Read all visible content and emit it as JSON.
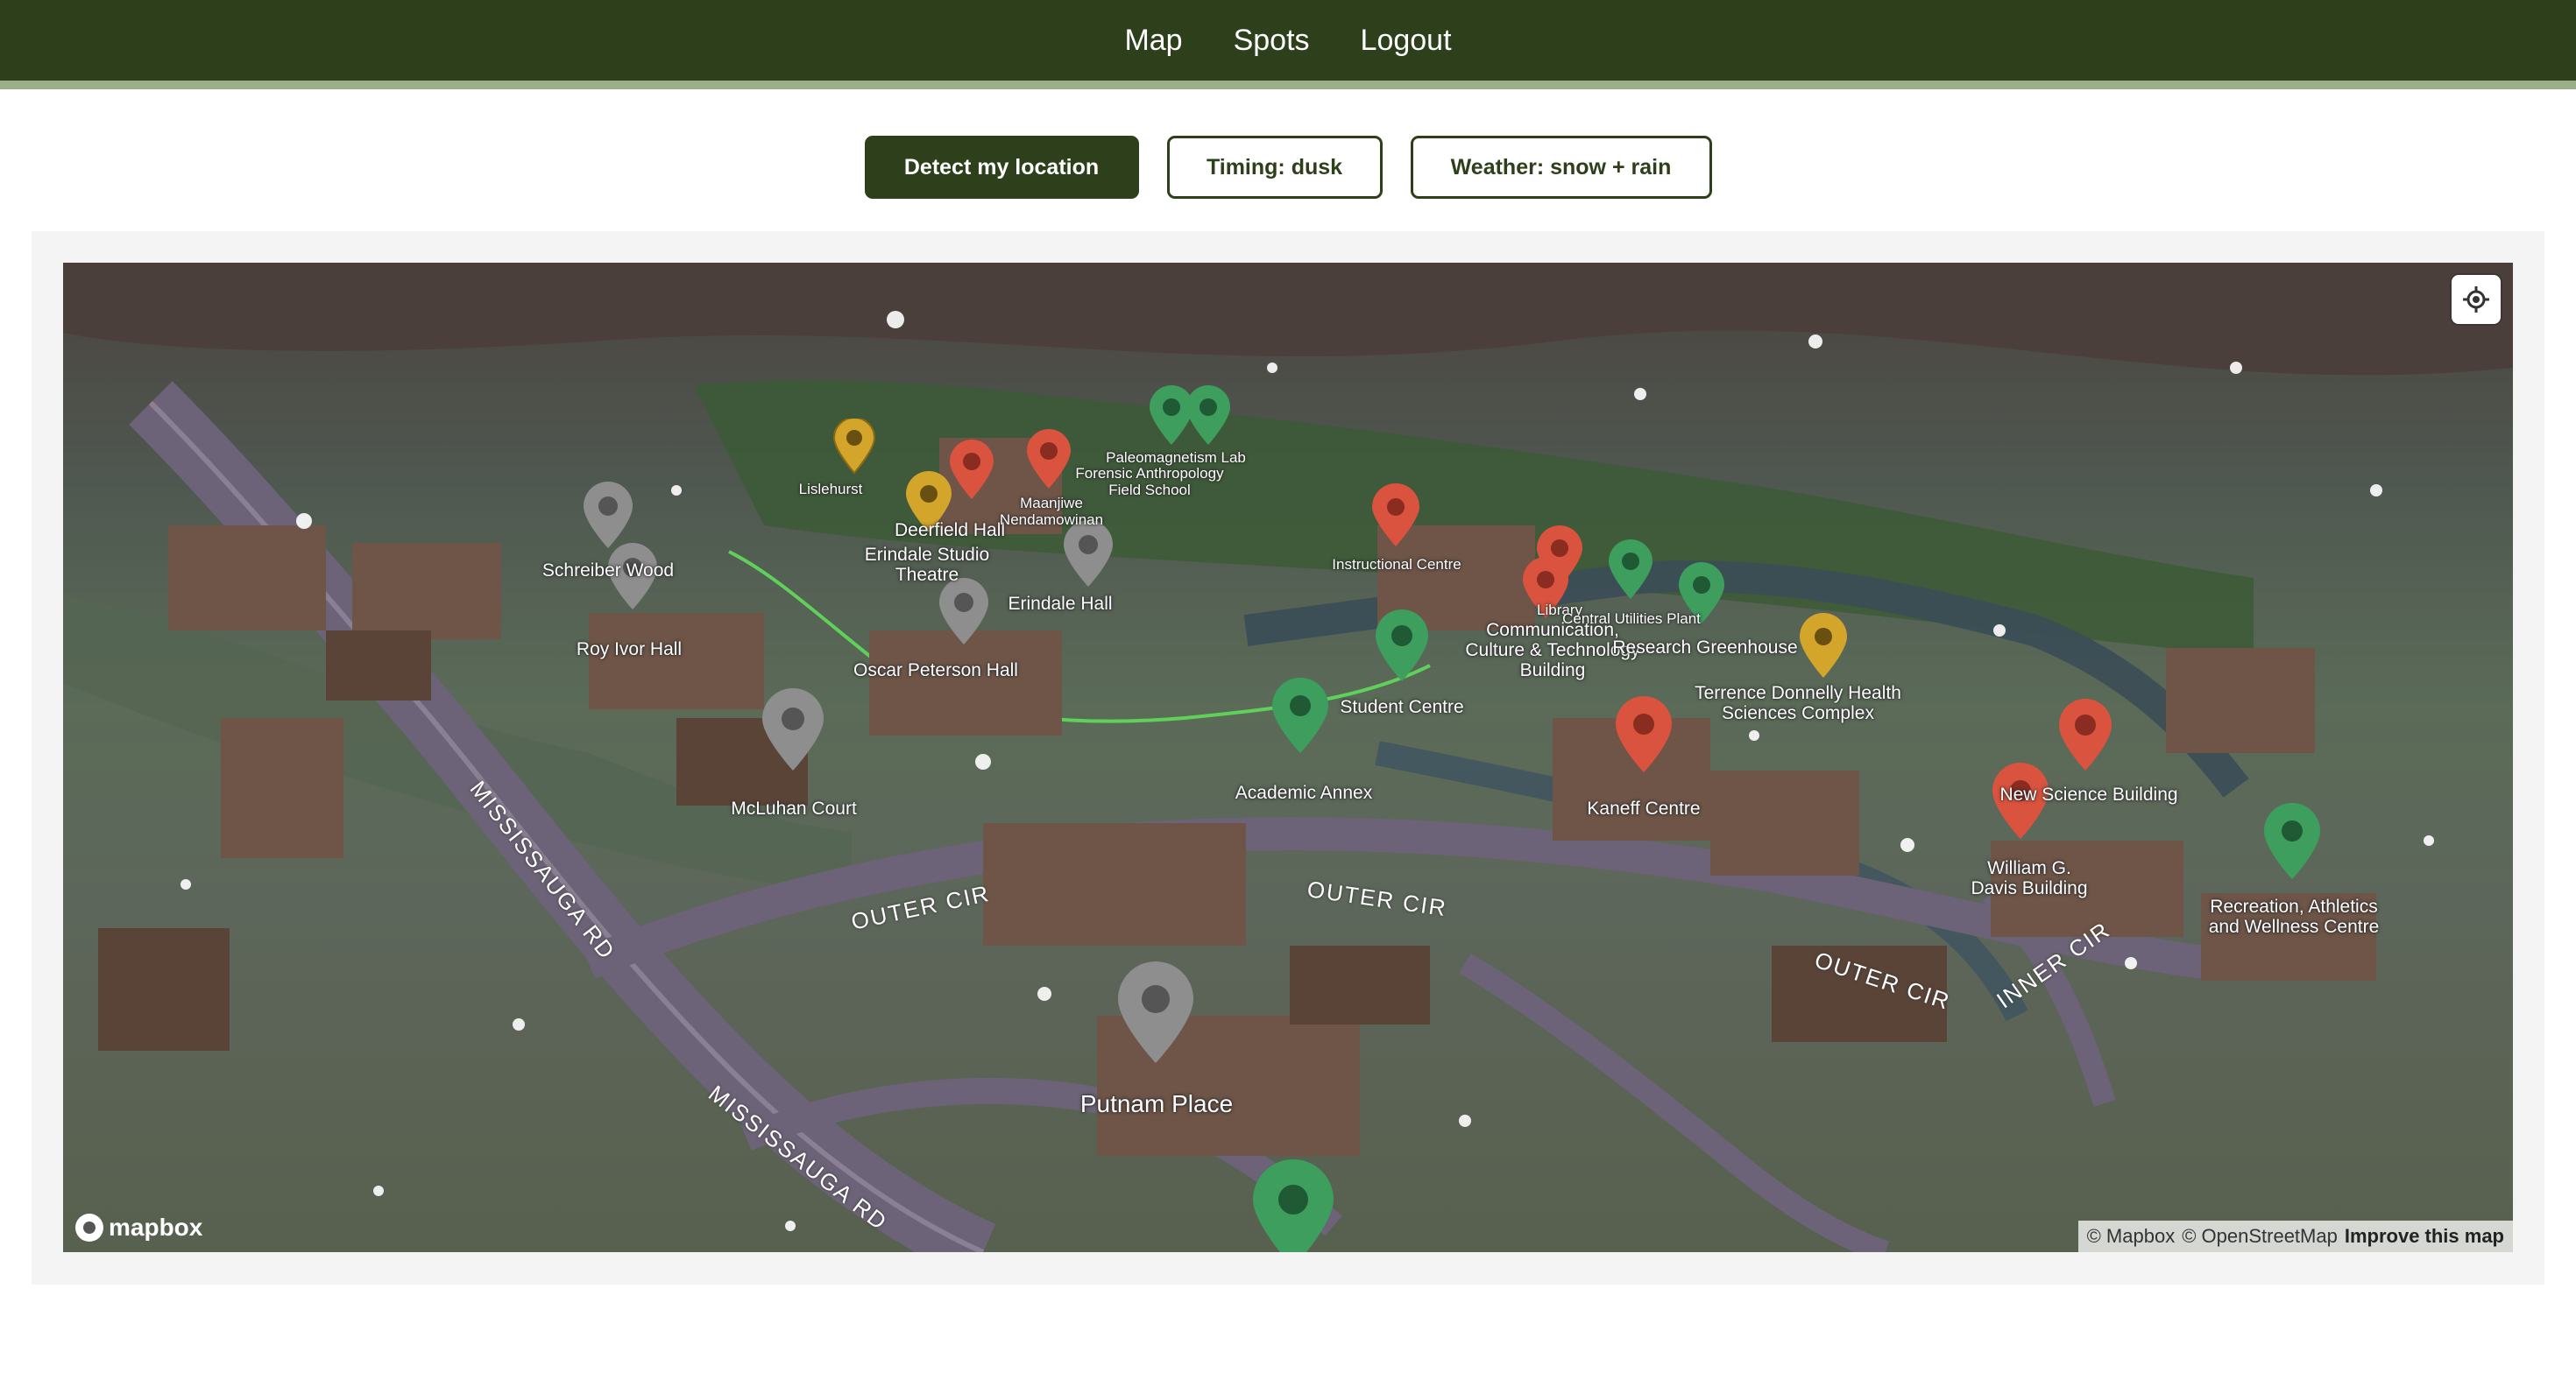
{
  "nav": {
    "items": [
      {
        "id": "map",
        "label": "Map"
      },
      {
        "id": "spots",
        "label": "Spots"
      },
      {
        "id": "logout",
        "label": "Logout"
      }
    ]
  },
  "controls": {
    "detect_label": "Detect my location",
    "timing_label": "Timing: dusk",
    "weather_label": "Weather: snow + rain"
  },
  "map": {
    "attribution": {
      "mapbox": "© Mapbox",
      "osm": "© OpenStreetMap",
      "improve": "Improve this map"
    },
    "logo_text": "mapbox",
    "labels": {
      "lislehurst": "Lislehurst",
      "deerfield": "Deerfield Hall",
      "erindale_theatre": "Erindale Studio\nTheatre",
      "maanjiwe": "Maanjiwe\nNendamowinan",
      "paleomagnetism": "Paleomagnetism Lab",
      "forensic": "Forensic Anthropology\nField School",
      "schreiber": "Schreiber Wood",
      "roy_ivor": "Roy Ivor Hall",
      "erindale_hall": "Erindale Hall",
      "oscar_peterson": "Oscar Peterson Hall",
      "instructional": "Instructional Centre",
      "library": "Library",
      "central_utilities": "Central Utilities Plant",
      "ccit": "Communication,\nCulture & Technology\nBuilding",
      "research_greenhouse": "Research Greenhouse",
      "student_centre": "Student Centre",
      "terrence_donnelly": "Terrence Donnelly Health\nSciences Complex",
      "mcluhan": "McLuhan Court",
      "academic_annex": "Academic Annex",
      "kaneff": "Kaneff Centre",
      "new_science": "New Science Building",
      "davis": "William G.\nDavis Building",
      "recreation": "Recreation, Athletics\nand Wellness Centre",
      "putnam": "Putnam Place"
    },
    "roads": {
      "mississauga_rd_1": "MISSISSAUGA RD",
      "mississauga_rd_2": "MISSISSAUGA RD",
      "outer_cir_1": "OUTER CIR",
      "outer_cir_2": "OUTER CIR",
      "outer_cir_3": "OUTER CIR",
      "inner_cir": "INNER CIR"
    },
    "marker_colors": {
      "red": "#d9533f",
      "green": "#3e9e5e",
      "gray": "#8e8e8e",
      "gold": "#d4a52b"
    }
  }
}
